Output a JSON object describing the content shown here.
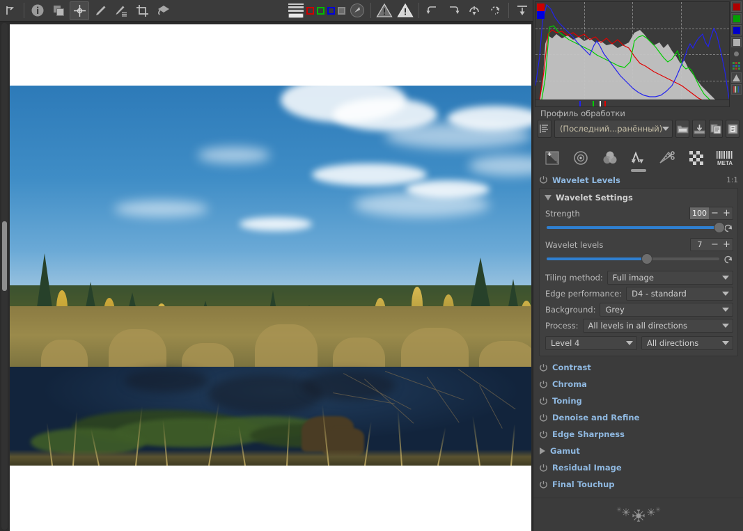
{
  "toolbar": {
    "left_tools": [
      {
        "name": "hand-tool",
        "icon": "hand-icon"
      },
      {
        "name": "info-tool",
        "icon": "info-icon"
      },
      {
        "name": "before-after-tool",
        "icon": "before-after-icon"
      },
      {
        "name": "crosshair-tool",
        "icon": "crosshair-icon",
        "selected": true
      },
      {
        "name": "white-balance-picker",
        "icon": "eyedropper-icon"
      },
      {
        "name": "spot-wb-picker",
        "icon": "eyedropper-lines-icon"
      },
      {
        "name": "crop-tool",
        "icon": "crop-icon"
      },
      {
        "name": "straighten-tool",
        "icon": "perspective-icon"
      }
    ],
    "histogram_modes": {
      "bars_icon": "histogram-bars-icon",
      "channels": [
        {
          "name": "red-channel-toggle",
          "color": "#cc0000"
        },
        {
          "name": "green-channel-toggle",
          "color": "#00bb00"
        },
        {
          "name": "blue-channel-toggle",
          "color": "#0000dd"
        },
        {
          "name": "luminance-channel-toggle",
          "color": "#888888"
        }
      ],
      "raw_icon": "raw-chroma-icon",
      "shadow_clip_icon": "shadow-clipping-warning-icon",
      "highlight_clip_icon": "highlight-clipping-warning-icon"
    },
    "history_tools": [
      {
        "name": "undo-button",
        "icon": "undo-icon"
      },
      {
        "name": "redo-button",
        "icon": "redo-icon"
      },
      {
        "name": "reset-button",
        "icon": "reset-icon"
      },
      {
        "name": "rotate-button",
        "icon": "rotate-icon"
      },
      {
        "name": "collapse-all-button",
        "icon": "collapse-down-icon"
      }
    ]
  },
  "histogram": {
    "channel_buttons": [
      {
        "name": "histogram-red-toggle",
        "color": "#b00000"
      },
      {
        "name": "histogram-green-toggle",
        "color": "#00a000"
      },
      {
        "name": "histogram-blue-toggle",
        "color": "#0000c8"
      },
      {
        "name": "histogram-luma-toggle",
        "color": "#b0b0b0"
      },
      {
        "name": "histogram-chroma-toggle",
        "color": "#7a7a7a"
      },
      {
        "name": "histogram-raw-toggle",
        "color": "#56a056"
      },
      {
        "name": "histogram-mode-toggle",
        "color": "#b5b5b5"
      },
      {
        "name": "histogram-parade-toggle",
        "color": "#c0c0c0"
      }
    ]
  },
  "profile": {
    "label": "Профиль обработки",
    "selected": "(Последний...ранённый)",
    "buttons": [
      {
        "name": "load-profile-button",
        "icon": "folder-icon"
      },
      {
        "name": "save-profile-button",
        "icon": "save-disk-icon"
      },
      {
        "name": "copy-profile-button",
        "icon": "copy-icon"
      },
      {
        "name": "paste-profile-button",
        "icon": "paste-icon"
      }
    ],
    "history_icon": "history-list-icon"
  },
  "tool_tabs": [
    {
      "name": "tab-exposure",
      "icon": "exposure-icon",
      "selected": false
    },
    {
      "name": "tab-detail",
      "icon": "detail-circle-icon",
      "selected": false
    },
    {
      "name": "tab-color",
      "icon": "color-venn-icon",
      "selected": false
    },
    {
      "name": "tab-advanced",
      "icon": "wavelet-peak-icon",
      "selected": true
    },
    {
      "name": "tab-transform",
      "icon": "transform-scissors-icon",
      "selected": false
    },
    {
      "name": "tab-raw",
      "icon": "raw-checker-icon",
      "selected": false
    },
    {
      "name": "tab-metadata",
      "icon": "meta-barcode-icon",
      "selected": false
    }
  ],
  "wavelet": {
    "title": "Wavelet Levels",
    "ratio": "1:1",
    "power_icon": "power-toggle-icon",
    "settings_title": "Wavelet Settings",
    "strength": {
      "label": "Strength",
      "value": "100",
      "minus": "−",
      "plus": "+",
      "percent": 100
    },
    "levels": {
      "label": "Wavelet levels",
      "value": "7",
      "minus": "−",
      "plus": "+",
      "percent": 58
    },
    "combos": [
      {
        "name": "tiling-method-combo",
        "label": "Tiling method:",
        "value": "Full image"
      },
      {
        "name": "edge-performance-combo",
        "label": "Edge performance:",
        "value": "D4 - standard"
      },
      {
        "name": "background-combo",
        "label": "Background:",
        "value": "Grey"
      },
      {
        "name": "process-combo",
        "label": "Process:",
        "value": "All levels in all directions"
      }
    ],
    "level_combo": "Level 4",
    "direction_combo": "All directions",
    "sections": [
      {
        "name": "section-contrast",
        "label": "Contrast",
        "expander": "power"
      },
      {
        "name": "section-chroma",
        "label": "Chroma",
        "expander": "power"
      },
      {
        "name": "section-toning",
        "label": "Toning",
        "expander": "power"
      },
      {
        "name": "section-denoise-and-refine",
        "label": "Denoise and Refine",
        "expander": "power"
      },
      {
        "name": "section-edge-sharpness",
        "label": "Edge Sharpness",
        "expander": "power"
      },
      {
        "name": "section-gamut",
        "label": "Gamut",
        "expander": "triangle"
      },
      {
        "name": "section-residual-image",
        "label": "Residual Image",
        "expander": "power"
      },
      {
        "name": "section-final-touchup",
        "label": "Final Touchup",
        "expander": "power"
      }
    ]
  },
  "footer": {
    "ornament": "snowflake-ornament-icon"
  },
  "colors": {
    "panel_bg": "#3b3b3b",
    "box_bg": "#404040",
    "accent_blue": "#2f7fd0",
    "header_blue": "#8fb8e0",
    "text": "#cfcfcf"
  }
}
